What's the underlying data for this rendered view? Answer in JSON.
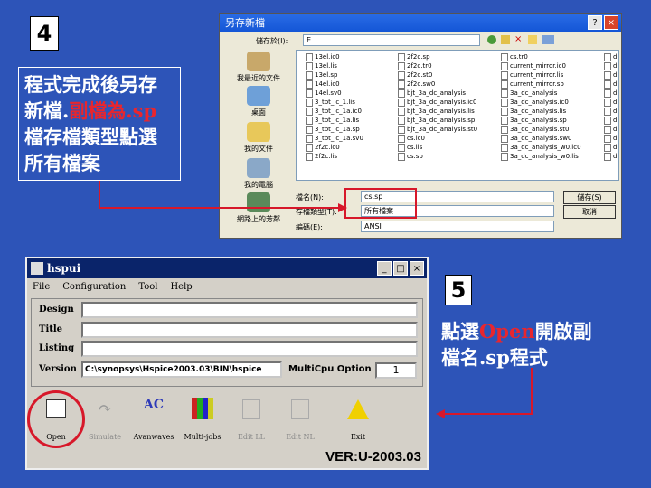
{
  "slide": {
    "step4_number": "4",
    "step4_note_line1": "程式完成後另存",
    "step4_note_line2_prefix": "新檔.",
    "step4_note_line2_red": "副檔為.sp",
    "step4_note_line3": "檔存檔類型點選",
    "step4_note_line4": "所有檔案",
    "step5_number": "5",
    "step5_note_prefix": "點選",
    "step5_note_red": "Open",
    "step5_note_suffix": "開啟副",
    "step5_note_line2": "檔名.sp程式",
    "colors": {
      "background": "#2d54b8",
      "accent_red": "#e8262e",
      "arrow_red": "#d7182a"
    }
  },
  "save_dialog": {
    "title": "另存新檔",
    "save_in_label": "儲存於(I):",
    "save_in_value": "E",
    "places": [
      "我最近的文件",
      "桌面",
      "我的文件",
      "我的電腦",
      "網路上的芳鄰"
    ],
    "files_col1": [
      "13el.ic0",
      "13el.lis",
      "13el.sp",
      "14el.ic0",
      "14el.sv0",
      "3_tbt_lc_1.lis",
      "3_tbt_lc_1a.ic0",
      "3_tbt_lc_1a.lis",
      "3_tbt_lc_1a.sp",
      "3_tbt_lc_1a.sv0",
      "2f2c.ic0",
      "2f2c.lis"
    ],
    "files_col2": [
      "2f2c.sp",
      "2f2c.tr0",
      "2f2c.st0",
      "2f2c.sw0",
      "bjt_3a_dc_analysis",
      "bjt_3a_dc_analysis.ic0",
      "bjt_3a_dc_analysis.lis",
      "bjt_3a_dc_analysis.sp",
      "bjt_3a_dc_analysis.st0",
      "cs.ic0",
      "cs.lis",
      "cs.sp"
    ],
    "files_col3": [
      "cs.tr0",
      "current_mirror.ic0",
      "current_mirror.lis",
      "current_mirror.sp",
      "3a_dc_analysis",
      "3a_dc_analysis.ic0",
      "3a_dc_analysis.lis",
      "3a_dc_analysis.sp",
      "3a_dc_analysis.st0",
      "3a_dc_analysis.sw0",
      "3a_dc_analysis_w0.ic0",
      "3a_dc_analysis_w0.lis"
    ],
    "filename_label": "檔名(N):",
    "filename_value": "cs.sp",
    "filetype_label": "存檔類型(T):",
    "filetype_value": "所有檔案",
    "encoding_label": "編碼(E):",
    "encoding_value": "ANSI",
    "save_button": "儲存(S)",
    "cancel_button": "取消"
  },
  "hspui": {
    "title": "hspui",
    "menu": [
      "File",
      "Configuration",
      "Tool",
      "Help"
    ],
    "design_label": "Design",
    "title_label": "Title",
    "listing_label": "Listing",
    "version_label": "Version",
    "version_value": "C:\\synopsys\\Hspice2003.03\\BIN\\hspice",
    "multicpu_label": "MultiCpu Option",
    "multicpu_value": "1",
    "tools": [
      "Open",
      "Simulate",
      "Avanwaves",
      "Multi-jobs",
      "Edit LL",
      "Edit NL",
      "Exit"
    ],
    "version_footer": "VER:U-2003.03"
  }
}
